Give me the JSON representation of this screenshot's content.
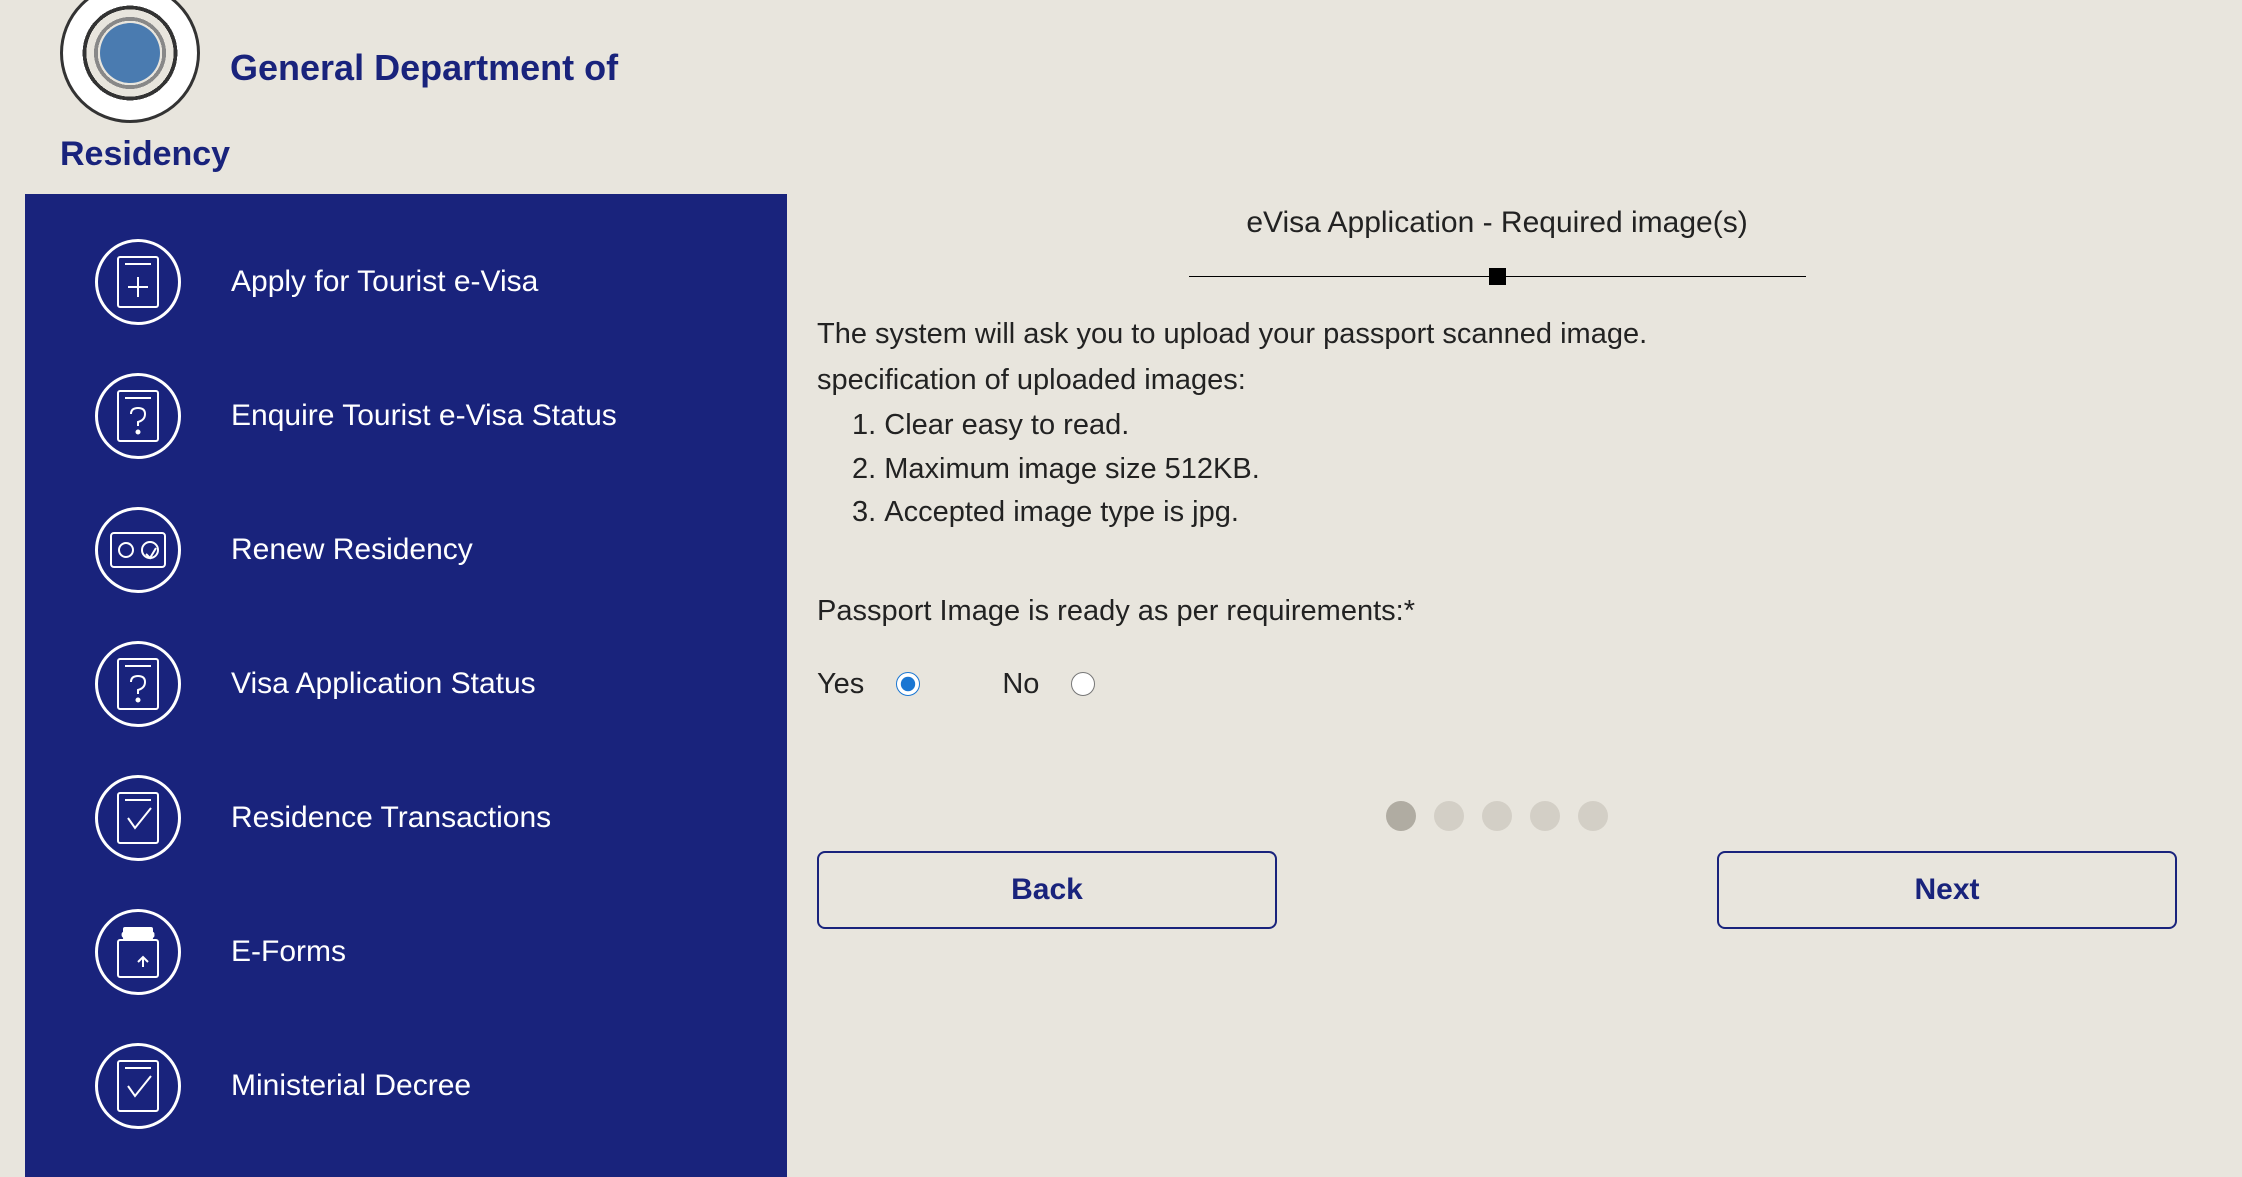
{
  "header": {
    "title": "General Department of",
    "subtitle": "Residency"
  },
  "sidebar": {
    "items": [
      {
        "label": "Apply for Tourist e-Visa",
        "icon": "plus-document"
      },
      {
        "label": "Enquire Tourist e-Visa Status",
        "icon": "question-document"
      },
      {
        "label": "Renew Residency",
        "icon": "id-card-renew"
      },
      {
        "label": "Visa Application Status",
        "icon": "question-document"
      },
      {
        "label": "Residence Transactions",
        "icon": "check-document"
      },
      {
        "label": "E-Forms",
        "icon": "eforms-document"
      },
      {
        "label": "Ministerial Decree",
        "icon": "check-document"
      }
    ]
  },
  "main": {
    "form_title": "eVisa Application - Required image(s)",
    "intro_line1": "The system will ask you to upload your passport scanned image.",
    "intro_line2": "specification of uploaded images:",
    "specs": [
      "Clear easy to read.",
      "Maximum image size 512KB.",
      "Accepted image type is jpg."
    ],
    "confirm_label": "Passport Image is ready as per requirements:*",
    "yes_label": "Yes",
    "no_label": "No",
    "selected": "yes",
    "back_label": "Back",
    "next_label": "Next",
    "step_count": 5,
    "current_step": 1
  }
}
